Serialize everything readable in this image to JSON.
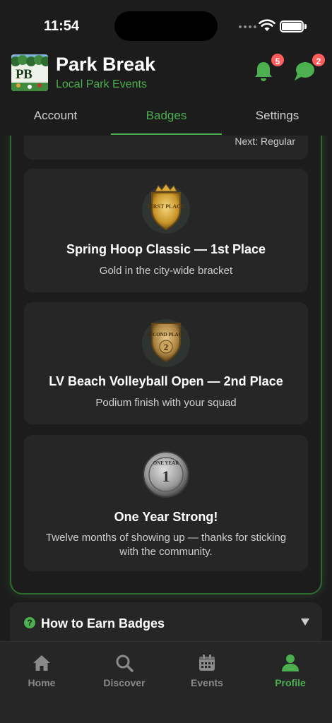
{
  "status": {
    "time": "11:54"
  },
  "app": {
    "title": "Park Break",
    "subtitle": "Local Park Events",
    "logo_text": "PB"
  },
  "header": {
    "notifications": {
      "icon": "bell-icon",
      "count": "5"
    },
    "messages": {
      "icon": "chat-bubble-icon",
      "count": "2"
    }
  },
  "tabs": [
    {
      "label": "Account",
      "active": false
    },
    {
      "label": "Badges",
      "active": true
    },
    {
      "label": "Settings",
      "active": false
    }
  ],
  "level": {
    "next": "Next: Regular"
  },
  "badges": [
    {
      "icon": "first-place-shield-icon",
      "emblem_text": "FIRST PLACE",
      "title": "Spring Hoop Classic — 1st Place",
      "description": "Gold in the city-wide bracket"
    },
    {
      "icon": "second-place-shield-icon",
      "emblem_text": "SECOND PLACE",
      "title": "LV Beach Volleyball Open — 2nd Place",
      "description": "Podium finish with your squad"
    },
    {
      "icon": "one-year-coin-icon",
      "emblem_text": "ONE YEAR",
      "title": "One Year Strong!",
      "description": "Twelve months of showing up — thanks for sticking with the community."
    }
  ],
  "earn": {
    "label": "How to Earn Badges",
    "icon": "help-icon"
  },
  "nav": [
    {
      "label": "Home",
      "icon": "home-icon",
      "active": false
    },
    {
      "label": "Discover",
      "icon": "search-icon",
      "active": false
    },
    {
      "label": "Events",
      "icon": "calendar-icon",
      "active": false
    },
    {
      "label": "Profile",
      "icon": "person-icon",
      "active": true
    }
  ],
  "colors": {
    "accent": "#4caf50",
    "background": "#1c1c1c",
    "card": "#262626",
    "badge_red": "#ff5c5c"
  }
}
